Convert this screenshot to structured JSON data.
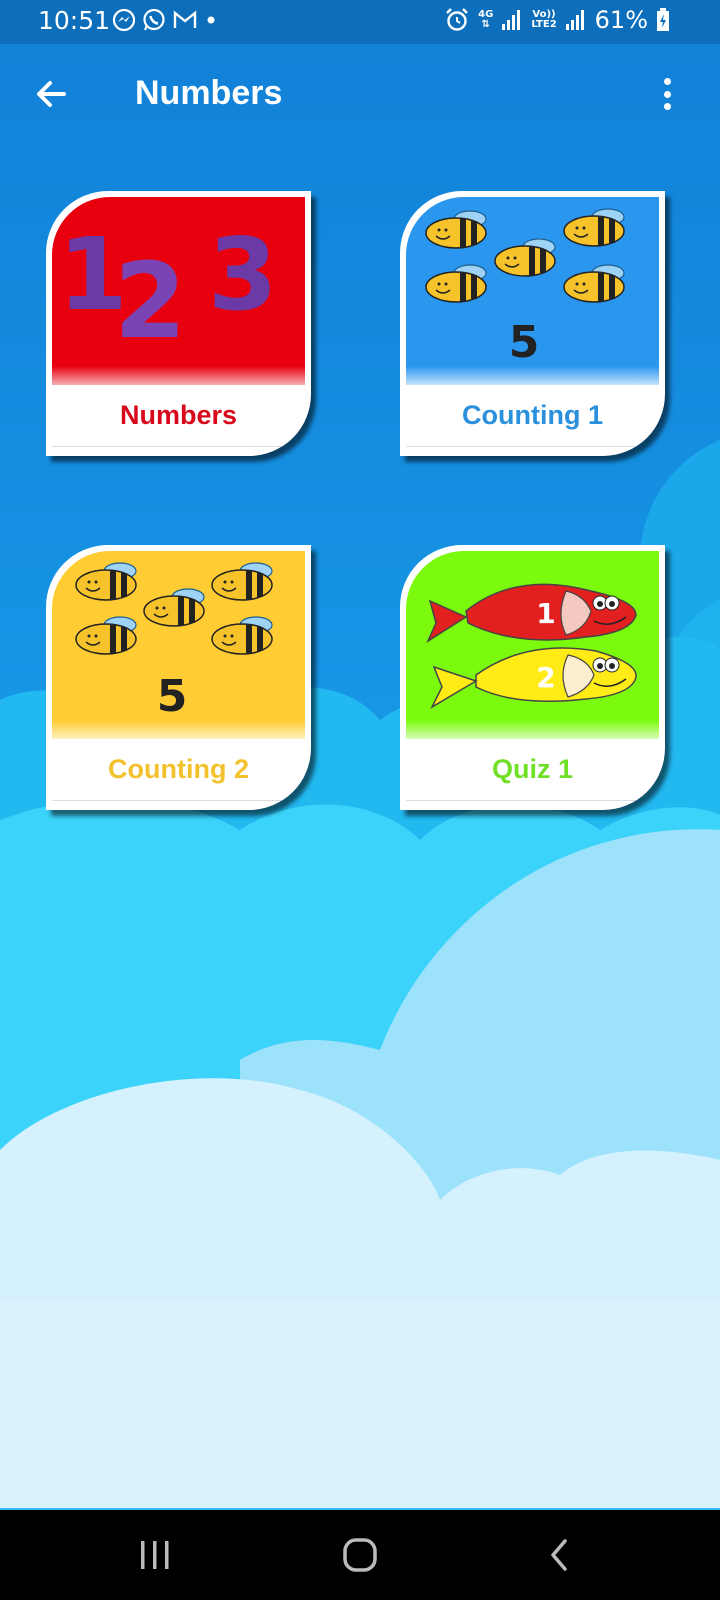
{
  "status_bar": {
    "time": "10:51",
    "network_4g": "4G",
    "volte": "Vo))",
    "lte2": "LTE2",
    "battery": "61%"
  },
  "app_bar": {
    "title": "Numbers",
    "back_icon": "arrow-left-icon",
    "menu_icon": "more-vertical-icon"
  },
  "cards": [
    {
      "label": "Numbers",
      "label_color": "#d9091c",
      "bg_color": "#e8000f",
      "image": "123-digits"
    },
    {
      "label": "Counting 1",
      "label_color": "#2b91dc",
      "bg_color": "#2b96ee",
      "image": "five-bees",
      "number": "5"
    },
    {
      "label": "Counting 2",
      "label_color": "#f3c12b",
      "bg_color": "#ffcc33",
      "image": "five-bees",
      "number": "5"
    },
    {
      "label": "Quiz 1",
      "label_color": "#70e027",
      "bg_color": "#7cfa0d",
      "image": "two-fish",
      "fish_numbers": [
        "1",
        "2"
      ]
    }
  ],
  "digits": [
    "1",
    "2",
    "3"
  ],
  "nav_bar": {
    "recents_icon": "recents-icon",
    "home_icon": "home-icon",
    "back_icon": "nav-back-icon"
  }
}
